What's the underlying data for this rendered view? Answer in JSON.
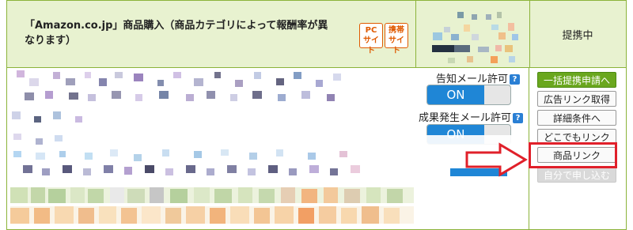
{
  "header": {
    "title_line1": "「Amazon.co.jp」商品購入（商品カテゴリによって報酬率が異",
    "title_line2": "なります）",
    "badge_pc": "PC\nサイト",
    "badge_mobile": "携帯\nサイト",
    "status": "提携中"
  },
  "permissions": {
    "notify_mail_label": "告知メール許可",
    "notify_mail_value": "ON",
    "result_mail_label": "成果発生メール許可",
    "result_mail_value": "ON"
  },
  "actions": {
    "bulk_apply": "一括提携申請へ",
    "get_ad_link": "広告リンク取得",
    "details": "詳細条件へ",
    "anywhere_link": "どこでもリンク",
    "product_link": "商品リンク",
    "self_apply": "自分で申し込む"
  },
  "colors": {
    "accent_green": "#6aa71e",
    "header_bg": "#e8f2d0",
    "toggle_blue": "#1f86d6",
    "highlight_red": "#e0202a"
  }
}
